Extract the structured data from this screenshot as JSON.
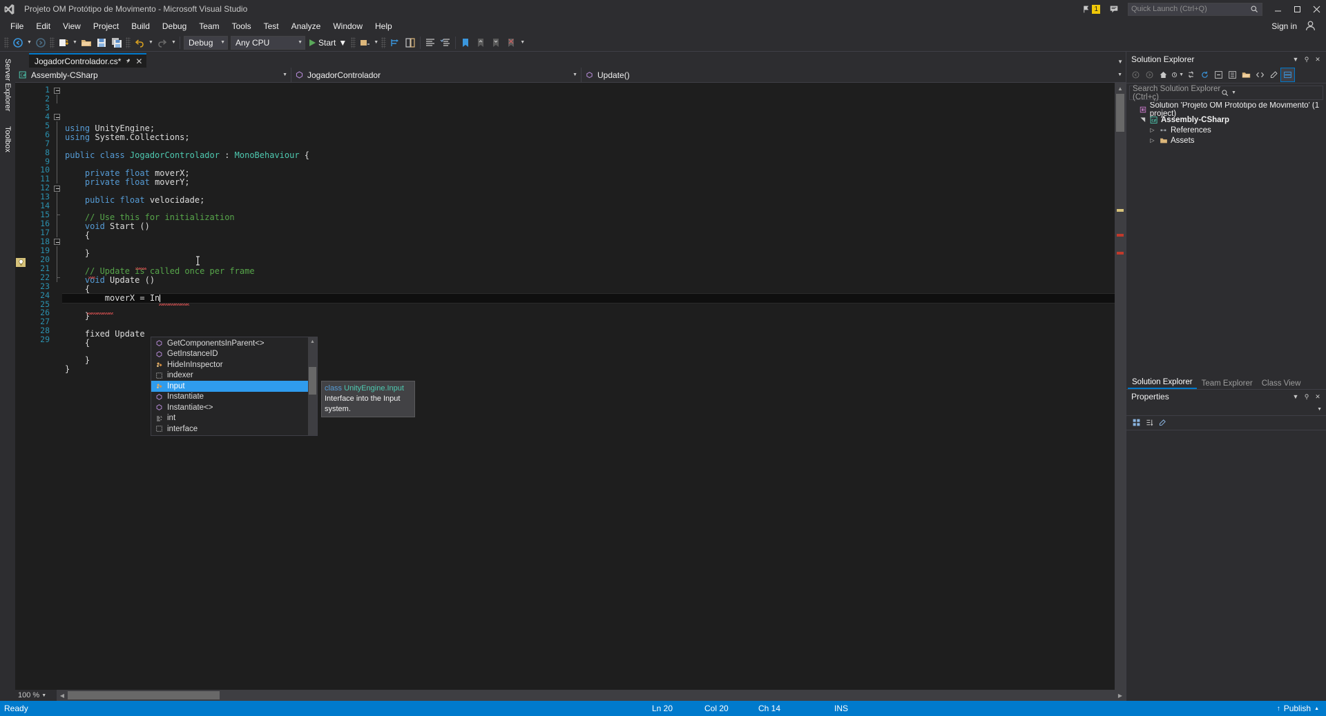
{
  "window": {
    "title": "Projeto OM Protótipo de Movimento - Microsoft Visual Studio",
    "notification_count": "1",
    "sign_in": "Sign in"
  },
  "menu": {
    "items": [
      "File",
      "Edit",
      "View",
      "Project",
      "Build",
      "Debug",
      "Team",
      "Tools",
      "Test",
      "Analyze",
      "Window",
      "Help"
    ]
  },
  "quick_launch": {
    "placeholder": "Quick Launch (Ctrl+Q)",
    "icon": "search-icon"
  },
  "toolbar": {
    "configuration": "Debug",
    "platform": "Any CPU",
    "start_label": "Start",
    "icons": [
      "navigate-back-icon",
      "navigate-forward-icon",
      "new-project-icon",
      "open-file-icon",
      "save-icon",
      "save-all-icon",
      "undo-icon",
      "redo-icon",
      "attach-icon",
      "step-icon",
      "comment-icon",
      "uncomment-icon",
      "bookmark-icon",
      "prev-bookmark-icon",
      "next-bookmark-icon",
      "clear-bookmarks-icon"
    ]
  },
  "left_rail": {
    "tabs": [
      "Server Explorer",
      "Toolbox"
    ]
  },
  "document": {
    "tab_label": "JogadorControlador.cs*",
    "pin_icon": "pin-icon",
    "close_icon": "close-icon"
  },
  "nav_bar": {
    "project": "Assembly-CSharp",
    "type": "JogadorControlador",
    "member": "Update()",
    "project_icon": "csharp-project-icon",
    "type_icon": "class-icon",
    "member_icon": "method-icon"
  },
  "editor": {
    "zoom": "100 %",
    "lines": [
      {
        "n": "1",
        "fold": "open",
        "tokens": [
          {
            "t": "using ",
            "c": "kw"
          },
          {
            "t": "UnityEngine;",
            "c": "pln"
          }
        ],
        "indent": 0
      },
      {
        "n": "2",
        "fold": "bar",
        "tokens": [
          {
            "t": "using ",
            "c": "kw"
          },
          {
            "t": "System.Collections;",
            "c": "pln"
          }
        ],
        "indent": 0
      },
      {
        "n": "3",
        "fold": "none",
        "tokens": [],
        "indent": 0
      },
      {
        "n": "4",
        "fold": "open",
        "tokens": [
          {
            "t": "public class ",
            "c": "kw"
          },
          {
            "t": "JogadorControlador",
            "c": "typ"
          },
          {
            "t": " : ",
            "c": "pln"
          },
          {
            "t": "MonoBehaviour",
            "c": "typ"
          },
          {
            "t": " {",
            "c": "pln"
          }
        ],
        "indent": 0
      },
      {
        "n": "5",
        "fold": "bar",
        "tokens": [],
        "indent": 0
      },
      {
        "n": "6",
        "fold": "bar",
        "tokens": [
          {
            "t": "private float ",
            "c": "kw"
          },
          {
            "t": "moverX;",
            "c": "pln"
          }
        ],
        "indent": 1
      },
      {
        "n": "7",
        "fold": "bar",
        "tokens": [
          {
            "t": "private float ",
            "c": "kw"
          },
          {
            "t": "moverY;",
            "c": "pln"
          }
        ],
        "indent": 1
      },
      {
        "n": "8",
        "fold": "bar",
        "tokens": [],
        "indent": 0
      },
      {
        "n": "9",
        "fold": "bar",
        "tokens": [
          {
            "t": "public float ",
            "c": "kw"
          },
          {
            "t": "velocidade;",
            "c": "pln"
          }
        ],
        "indent": 1
      },
      {
        "n": "10",
        "fold": "bar",
        "tokens": [],
        "indent": 0
      },
      {
        "n": "11",
        "fold": "bar",
        "tokens": [
          {
            "t": "// Use this for initialization",
            "c": "cmt"
          }
        ],
        "indent": 1
      },
      {
        "n": "12",
        "fold": "open",
        "tokens": [
          {
            "t": "void ",
            "c": "kw"
          },
          {
            "t": "Start ()",
            "c": "pln"
          }
        ],
        "indent": 1
      },
      {
        "n": "13",
        "fold": "bar",
        "tokens": [
          {
            "t": "{",
            "c": "pln"
          }
        ],
        "indent": 1
      },
      {
        "n": "14",
        "fold": "bar",
        "tokens": [],
        "indent": 0
      },
      {
        "n": "15",
        "fold": "endbar",
        "tokens": [
          {
            "t": "}",
            "c": "pln"
          }
        ],
        "indent": 1
      },
      {
        "n": "16",
        "fold": "bar",
        "tokens": [],
        "indent": 0
      },
      {
        "n": "17",
        "fold": "bar",
        "tokens": [
          {
            "t": "// Update is called once per frame",
            "c": "cmt"
          }
        ],
        "indent": 1
      },
      {
        "n": "18",
        "fold": "open",
        "tokens": [
          {
            "t": "void ",
            "c": "kw"
          },
          {
            "t": "Update ()",
            "c": "pln"
          }
        ],
        "indent": 1
      },
      {
        "n": "19",
        "fold": "bar",
        "tokens": [
          {
            "t": "{",
            "c": "pln"
          }
        ],
        "indent": 1
      },
      {
        "n": "20",
        "fold": "bar",
        "tokens": [
          {
            "t": "moverX = In",
            "c": "pln"
          }
        ],
        "indent": 2,
        "current": true
      },
      {
        "n": "21",
        "fold": "bar",
        "tokens": [],
        "indent": 0
      },
      {
        "n": "22",
        "fold": "endbar",
        "tokens": [
          {
            "t": "}",
            "c": "pln"
          }
        ],
        "indent": 1
      },
      {
        "n": "23",
        "fold": "none",
        "tokens": [],
        "indent": 0
      },
      {
        "n": "24",
        "fold": "none",
        "tokens": [
          {
            "t": "fixed Update",
            "c": "pln"
          }
        ],
        "indent": 1
      },
      {
        "n": "25",
        "fold": "none",
        "tokens": [
          {
            "t": "{",
            "c": "pln"
          }
        ],
        "indent": 1
      },
      {
        "n": "26",
        "fold": "none",
        "tokens": [],
        "indent": 0
      },
      {
        "n": "27",
        "fold": "none",
        "tokens": [
          {
            "t": "}",
            "c": "pln"
          }
        ],
        "indent": 1
      },
      {
        "n": "28",
        "fold": "none",
        "tokens": [
          {
            "t": "}",
            "c": "pln"
          }
        ],
        "indent": 0
      },
      {
        "n": "29",
        "fold": "none",
        "tokens": [],
        "indent": 0
      }
    ],
    "lightbulb_icon": "lightbulb-icon",
    "caret_line": "20"
  },
  "intellisense": {
    "items": [
      {
        "label": "GetComponentsInParent<>",
        "icon": "method-icon",
        "selected": false
      },
      {
        "label": "GetInstanceID",
        "icon": "method-icon",
        "selected": false
      },
      {
        "label": "HideInInspector",
        "icon": "class-icon",
        "selected": false
      },
      {
        "label": "indexer",
        "icon": "snippet-icon",
        "selected": false
      },
      {
        "label": "Input",
        "icon": "class-icon",
        "selected": true
      },
      {
        "label": "Instantiate",
        "icon": "method-icon",
        "selected": false
      },
      {
        "label": "Instantiate<>",
        "icon": "method-icon",
        "selected": false
      },
      {
        "label": "int",
        "icon": "keyword-icon",
        "selected": false
      },
      {
        "label": "interface",
        "icon": "snippet-icon",
        "selected": false
      }
    ],
    "tooltip": {
      "keyword": "class ",
      "signature": "UnityEngine.Input",
      "description": "Interface into the Input system."
    }
  },
  "solution_explorer": {
    "title": "Solution Explorer",
    "search_placeholder": "Search Solution Explorer (Ctrl+ç)",
    "toolbar_icons": [
      "back-icon",
      "forward-icon",
      "home-icon",
      "pending-changes-icon",
      "sync-views-icon",
      "refresh-icon",
      "collapse-all-icon",
      "properties-icon",
      "show-all-files-icon",
      "view-code-icon",
      "view-designer-icon",
      "preview-selected-icon"
    ],
    "tree": [
      {
        "label": "Solution 'Projeto OM Protótipo de Movimento' (1 project)",
        "icon": "solution-icon",
        "depth": 0,
        "twisty": "",
        "bold": false
      },
      {
        "label": "Assembly-CSharp",
        "icon": "csharp-project-icon",
        "depth": 1,
        "twisty": "expanded",
        "bold": true
      },
      {
        "label": "References",
        "icon": "references-icon",
        "depth": 2,
        "twisty": "collapsed",
        "bold": false
      },
      {
        "label": "Assets",
        "icon": "folder-icon",
        "depth": 2,
        "twisty": "collapsed",
        "bold": false
      }
    ],
    "tabs": [
      {
        "label": "Solution Explorer",
        "active": true
      },
      {
        "label": "Team Explorer",
        "active": false
      },
      {
        "label": "Class View",
        "active": false
      }
    ]
  },
  "properties": {
    "title": "Properties",
    "toolbar_icons": [
      "categorized-icon",
      "alphabetical-icon",
      "property-pages-icon"
    ]
  },
  "status_bar": {
    "ready": "Ready",
    "line": "Ln 20",
    "column": "Col 20",
    "character": "Ch 14",
    "insert_mode": "INS",
    "publish": "Publish"
  },
  "colors": {
    "accent": "#007acc",
    "chrome": "#2d2d30",
    "editor_bg": "#1e1e1e",
    "selection": "#2f9ced",
    "keyword": "#569cd6",
    "type": "#4ec9b0",
    "comment": "#57a64a"
  }
}
